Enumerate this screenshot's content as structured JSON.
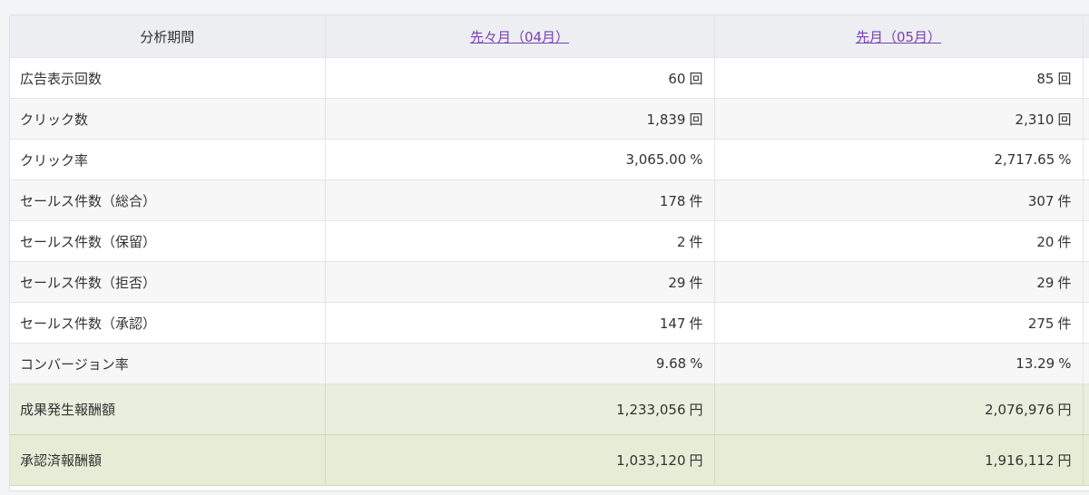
{
  "header": {
    "period_label": "分析期間",
    "col1_link": "先々月（04月）",
    "col2_link": "先月（05月）"
  },
  "rows": [
    {
      "label": "広告表示回数",
      "v1": "60",
      "u1": "回",
      "v2": "85",
      "u2": "回"
    },
    {
      "label": "クリック数",
      "v1": "1,839",
      "u1": "回",
      "v2": "2,310",
      "u2": "回"
    },
    {
      "label": "クリック率",
      "v1": "3,065.00",
      "u1": "%",
      "v2": "2,717.65",
      "u2": "%"
    },
    {
      "label": "セールス件数（総合）",
      "v1": "178",
      "u1": "件",
      "v2": "307",
      "u2": "件"
    },
    {
      "label": "セールス件数（保留）",
      "v1": "2",
      "u1": "件",
      "v2": "20",
      "u2": "件"
    },
    {
      "label": "セールス件数（拒否）",
      "v1": "29",
      "u1": "件",
      "v2": "29",
      "u2": "件"
    },
    {
      "label": "セールス件数（承認）",
      "v1": "147",
      "u1": "件",
      "v2": "275",
      "u2": "件"
    },
    {
      "label": "コンバージョン率",
      "v1": "9.68",
      "u1": "%",
      "v2": "13.29",
      "u2": "%"
    },
    {
      "label": "成果発生報酬額",
      "v1": "1,233,056",
      "u1": "円",
      "v2": "2,076,976",
      "u2": "円"
    },
    {
      "label": "承認済報酬額",
      "v1": "1,033,120",
      "u1": "円",
      "v2": "1,916,112",
      "u2": "円"
    }
  ],
  "colors": {
    "link": "#7b3fb3",
    "header_bg": "#eceef2",
    "reward_bg": "#e9eedd"
  }
}
